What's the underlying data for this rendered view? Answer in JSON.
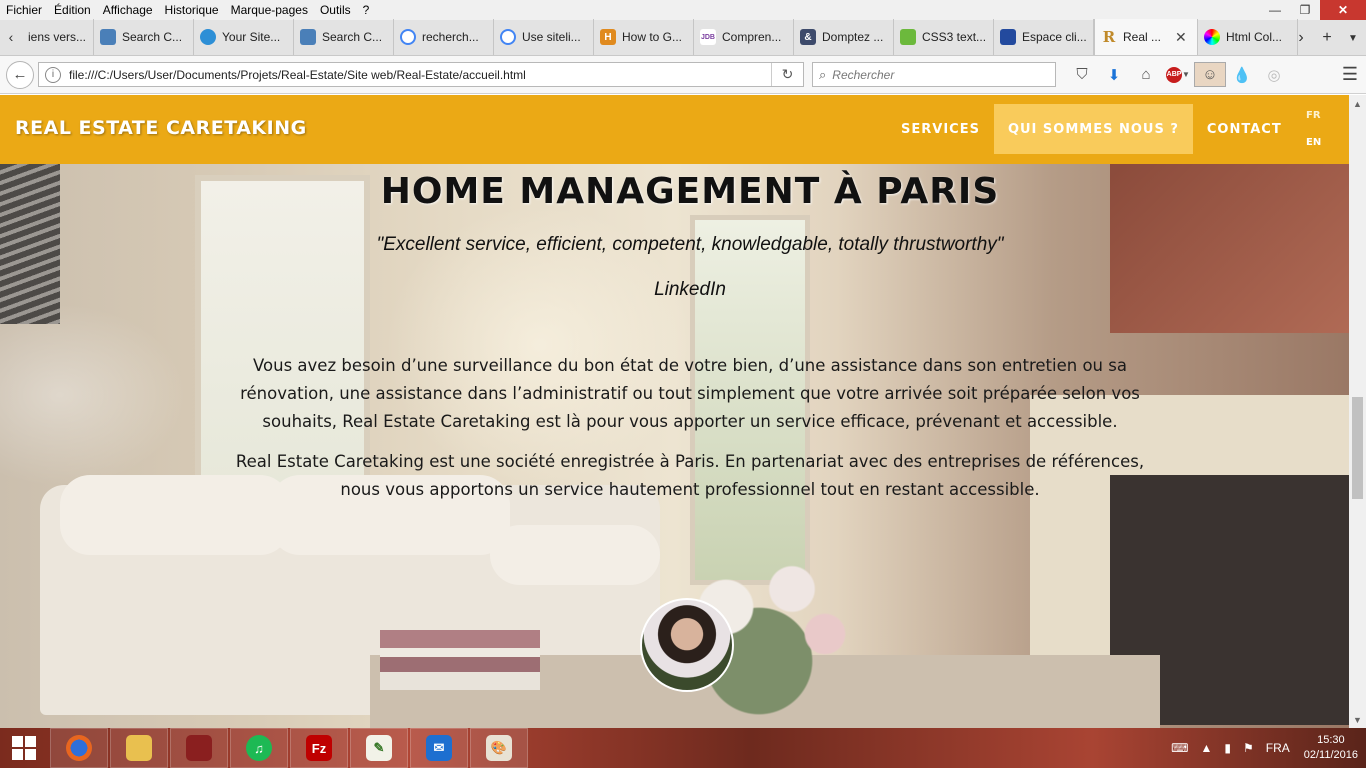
{
  "menubar": {
    "items": [
      "Fichier",
      "Édition",
      "Affichage",
      "Historique",
      "Marque-pages",
      "Outils",
      "?"
    ]
  },
  "tabs": [
    {
      "label": "iens vers..."
    },
    {
      "label": "Search C..."
    },
    {
      "label": "Your Site..."
    },
    {
      "label": "Search C..."
    },
    {
      "label": "recherch..."
    },
    {
      "label": "Use siteli..."
    },
    {
      "label": "How to G..."
    },
    {
      "label": "Compren..."
    },
    {
      "label": "Domptez ..."
    },
    {
      "label": "CSS3 text..."
    },
    {
      "label": "Espace cli..."
    },
    {
      "label": "Real ..."
    },
    {
      "label": "Html Col..."
    }
  ],
  "tab_icon_badges": {
    "how_to": "H",
    "compren": "JDB",
    "domptez": "&",
    "real": "R"
  },
  "navbar": {
    "url": "file:///C:/Users/User/Documents/Projets/Real-Estate/Site web/Real-Estate/accueil.html",
    "search_placeholder": "Rechercher",
    "abp_label": "ABP"
  },
  "site": {
    "brand": "REAL ESTATE CARETAKING",
    "menu": [
      "SERVICES",
      "QUI SOMMES NOUS ?",
      "CONTACT"
    ],
    "active_menu": "QUI SOMMES NOUS ?",
    "lang_fr": "FR",
    "lang_en": "EN",
    "heading": "HOME MANAGEMENT À PARIS",
    "quote": "\"Excellent service, efficient, competent, knowledgable, totally thrustworthy\"",
    "quote_source": "LinkedIn",
    "paragraph1": "Vous avez besoin d’une surveillance du bon état de votre bien, d’une assistance dans son entretien ou sa rénovation, une assistance dans l’administratif ou tout simplement que votre arrivée soit préparée selon vos souhaits, Real Estate Caretaking est là pour vous apporter un service efficace, prévenant et accessible.",
    "paragraph2": "Real Estate Caretaking est une société enregistrée à Paris. En partenariat avec des entreprises de références, nous vous apportons un service hautement professionnel tout en restant accessible."
  },
  "taskbar": {
    "apps": [
      "firefox",
      "file-explorer",
      "app",
      "spotify",
      "filezilla",
      "editor",
      "mail",
      "paint"
    ],
    "app_glyphs": {
      "spotify": "♫",
      "filezilla": "Fz",
      "mail": "✉"
    },
    "language": "FRA",
    "time": "15:30",
    "date": "02/11/2016"
  },
  "colors": {
    "header_bg": "#eba915",
    "active_menu_bg": "#f9cb5b"
  }
}
